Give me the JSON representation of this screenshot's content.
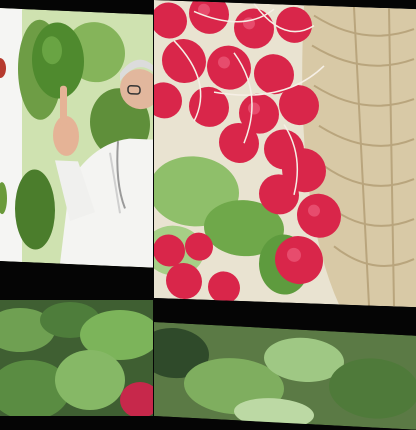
{
  "collage": {
    "tiles": [
      {
        "subject": "doctor-with-avocados"
      },
      {
        "subject": "radishes-in-basket"
      },
      {
        "subject": "leafy-greens"
      },
      {
        "subject": "leafy-greens"
      }
    ]
  },
  "colors": {
    "background": "#050505",
    "radish_red": "#d9264a",
    "leaf_green": "#5f9a3c",
    "basket_tan": "#d8c9a6",
    "coat_white": "#f4f4f2"
  }
}
